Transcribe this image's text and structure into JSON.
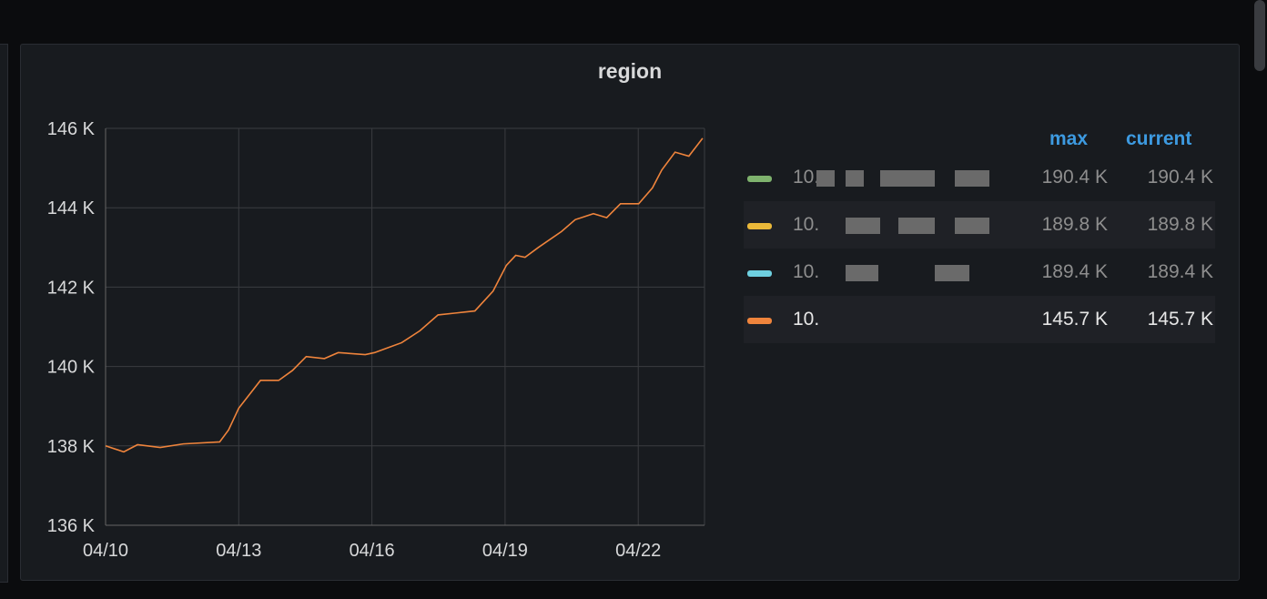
{
  "panel": {
    "title": "region"
  },
  "legend": {
    "headers": {
      "max": "max",
      "current": "current"
    },
    "items": [
      {
        "name": "10.",
        "max": "190.4 K",
        "current": "190.4 K",
        "color": "#7eb26d",
        "hidden": true
      },
      {
        "name": "10.",
        "max": "189.8 K",
        "current": "189.8 K",
        "color": "#eab839",
        "hidden": true
      },
      {
        "name": "10.",
        "max": "189.4 K",
        "current": "189.4 K",
        "color": "#6ed0e0",
        "hidden": true
      },
      {
        "name": "10.",
        "max": "145.7 K",
        "current": "145.7 K",
        "color": "#ef843c",
        "hidden": false
      }
    ]
  },
  "chart_data": {
    "type": "line",
    "title": "region",
    "x_ticks": [
      "04/10",
      "04/13",
      "04/16",
      "04/19",
      "04/22"
    ],
    "x_unit": "days since 04/10",
    "xlim": [
      0,
      13.45
    ],
    "y_ticks": [
      "136 K",
      "138 K",
      "140 K",
      "142 K",
      "144 K",
      "146 K"
    ],
    "ylim": [
      136,
      146
    ],
    "ylabel_unit": "K",
    "grid": true,
    "series": [
      {
        "name": "10.",
        "color": "#ef843c",
        "points": [
          [
            0,
            138.0
          ],
          [
            0.41,
            137.85
          ],
          [
            0.72,
            138.03
          ],
          [
            1.23,
            137.96
          ],
          [
            1.75,
            138.05
          ],
          [
            2.57,
            138.1
          ],
          [
            2.77,
            138.4
          ],
          [
            3.0,
            138.95
          ],
          [
            3.49,
            139.65
          ],
          [
            3.9,
            139.65
          ],
          [
            4.21,
            139.9
          ],
          [
            4.52,
            140.25
          ],
          [
            4.93,
            140.2
          ],
          [
            5.24,
            140.35
          ],
          [
            5.85,
            140.3
          ],
          [
            6.06,
            140.35
          ],
          [
            6.67,
            140.6
          ],
          [
            7.08,
            140.9
          ],
          [
            7.49,
            141.3
          ],
          [
            7.91,
            141.35
          ],
          [
            8.32,
            141.4
          ],
          [
            8.73,
            141.9
          ],
          [
            9.03,
            142.55
          ],
          [
            9.24,
            142.8
          ],
          [
            9.45,
            142.75
          ],
          [
            9.75,
            143.0
          ],
          [
            10.27,
            143.4
          ],
          [
            10.58,
            143.7
          ],
          [
            10.99,
            143.85
          ],
          [
            11.29,
            143.75
          ],
          [
            11.6,
            144.1
          ],
          [
            12.01,
            144.1
          ],
          [
            12.32,
            144.5
          ],
          [
            12.53,
            144.95
          ],
          [
            12.83,
            145.4
          ],
          [
            13.14,
            145.3
          ],
          [
            13.45,
            145.75
          ]
        ]
      }
    ]
  }
}
